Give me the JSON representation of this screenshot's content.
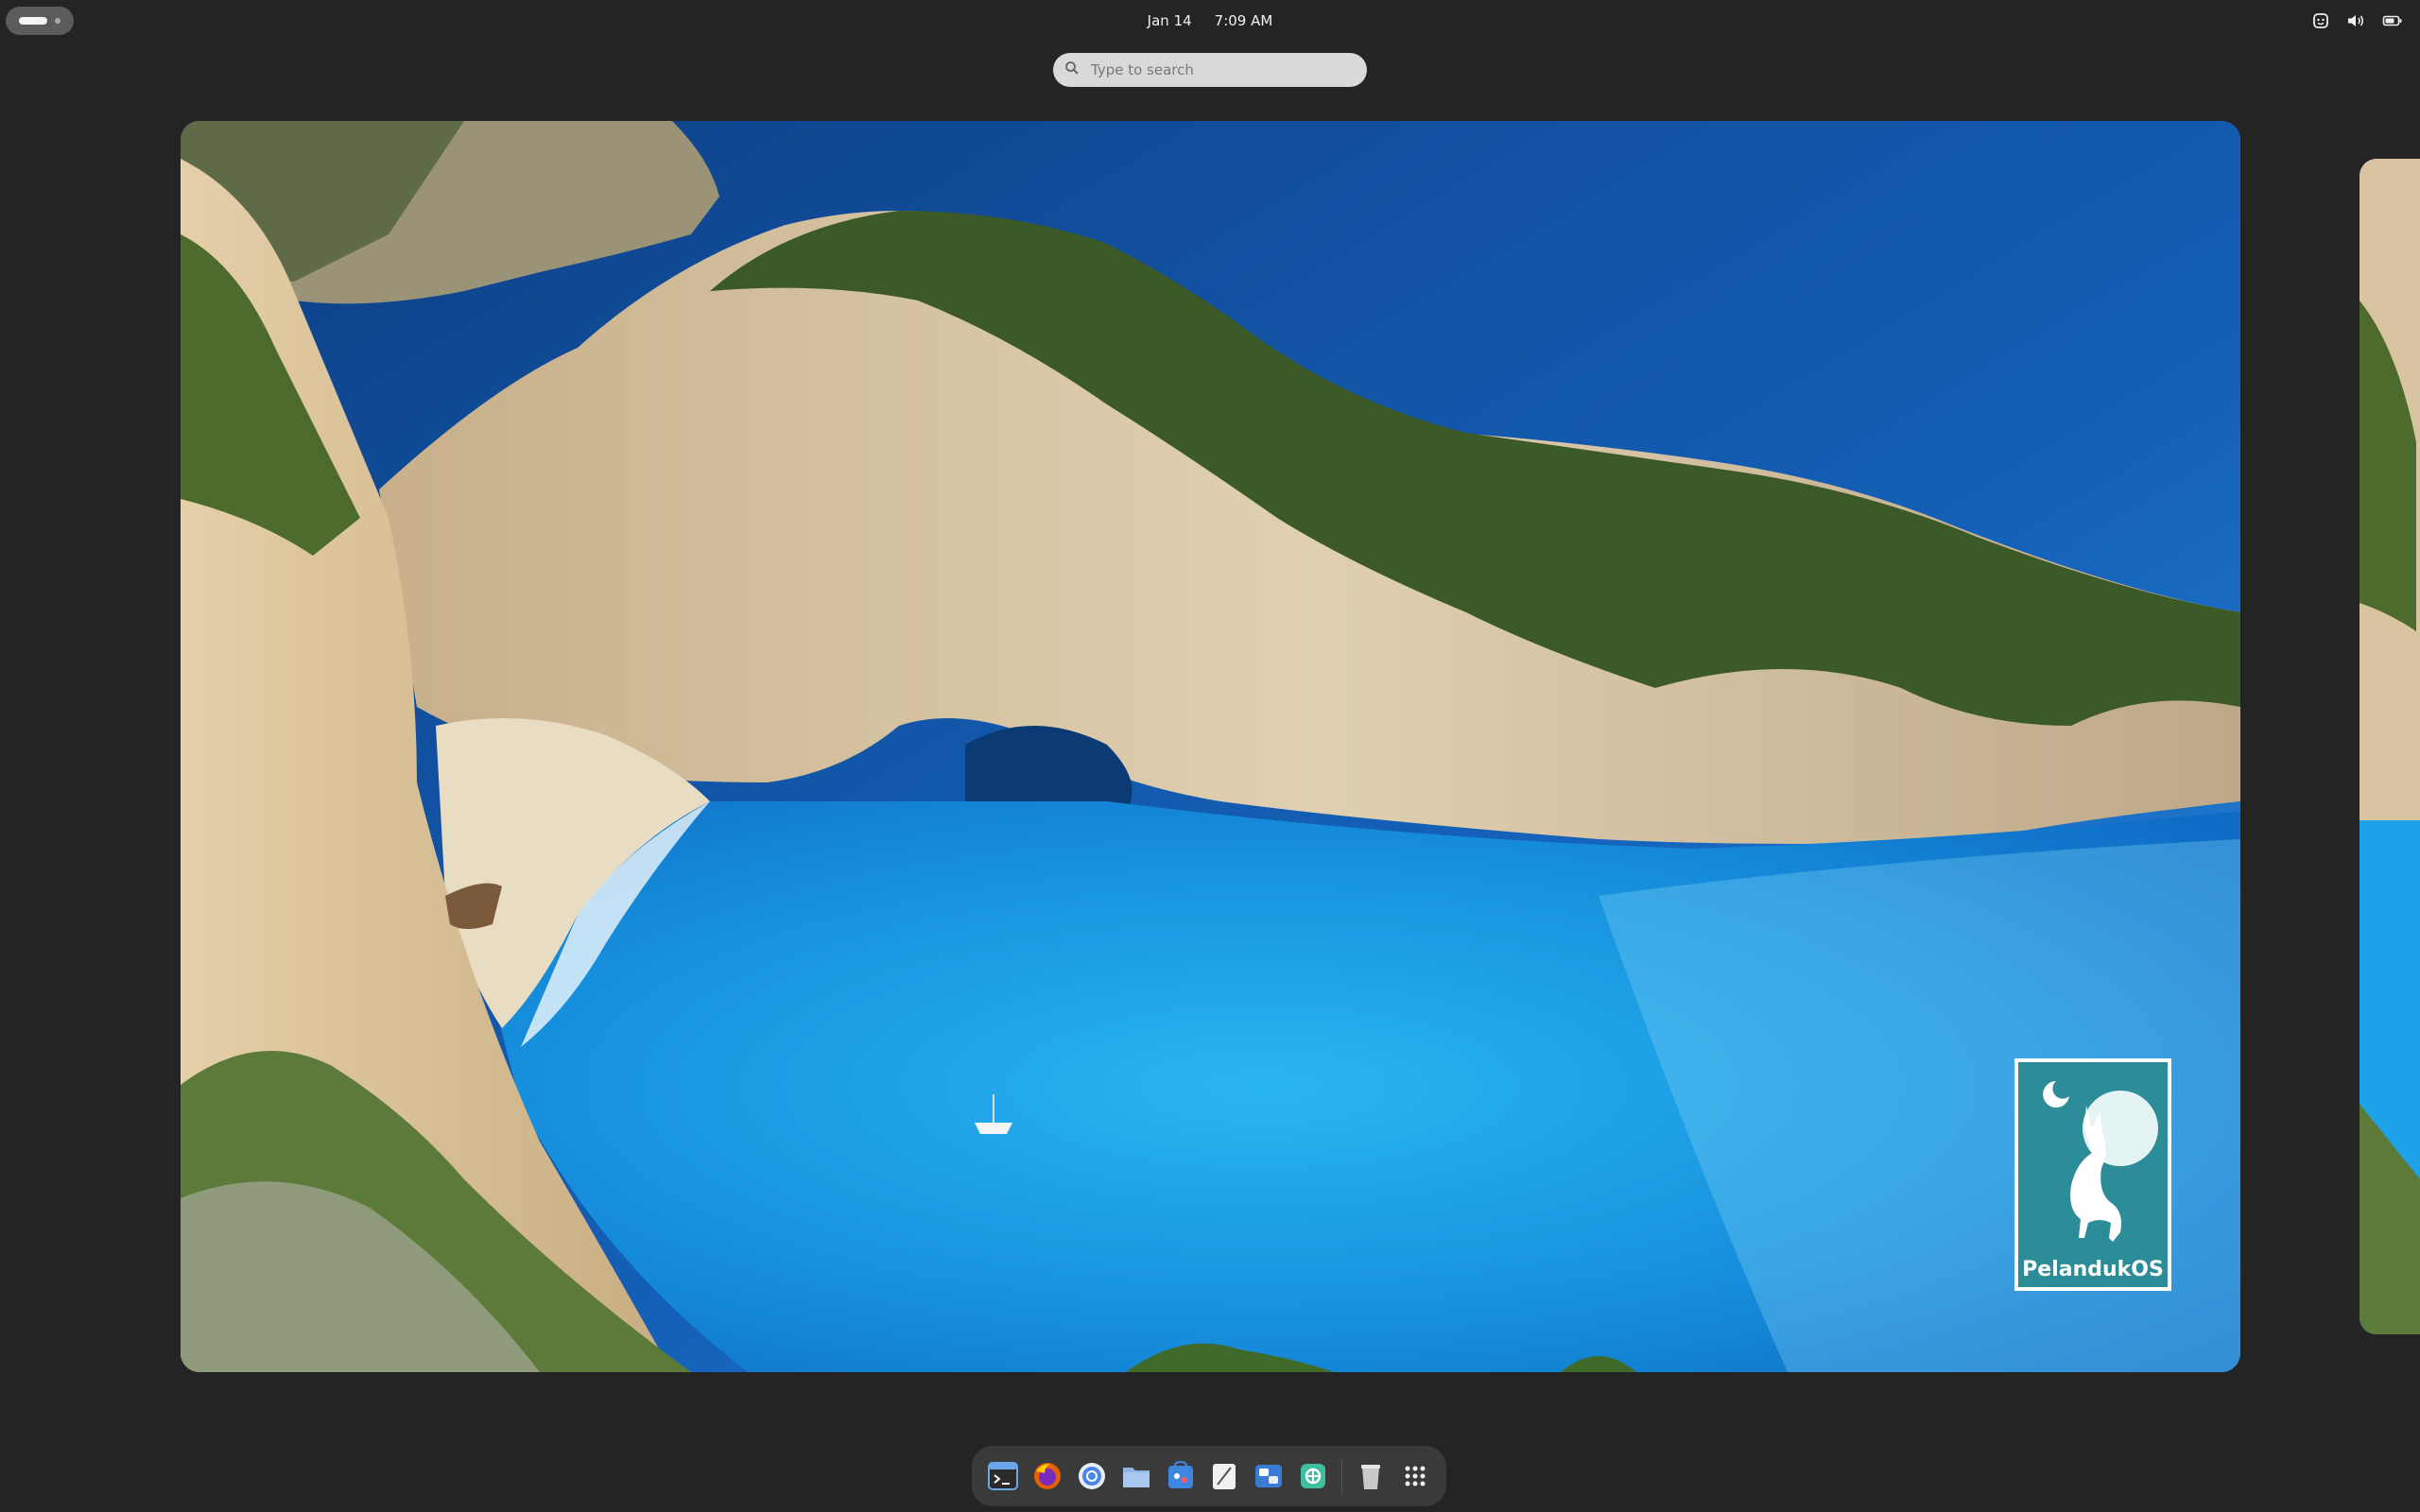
{
  "topbar": {
    "activities_label": "Activities",
    "date": "Jan 14",
    "time": "7:09 AM",
    "status_icons": [
      "accessibility-icon",
      "volume-icon",
      "battery-icon"
    ]
  },
  "search": {
    "placeholder": "Type to search"
  },
  "workspace": {
    "wallpaper_watermark": "PelandukOS",
    "colors": {
      "sky_sea_deep": "#0f4d97",
      "sea_shallow": "#1aa3ea",
      "cliff": "#d9c6a3",
      "forest": "#3f5e2a",
      "logo_teal": "#2c8d99"
    }
  },
  "dash": {
    "apps": [
      {
        "name": "Terminal",
        "icon": "terminal-icon"
      },
      {
        "name": "Firefox",
        "icon": "firefox-icon"
      },
      {
        "name": "Chromium",
        "icon": "chromium-icon"
      },
      {
        "name": "Files",
        "icon": "files-icon"
      },
      {
        "name": "Software",
        "icon": "software-icon"
      },
      {
        "name": "Text Editor",
        "icon": "text-editor-icon"
      },
      {
        "name": "Settings",
        "icon": "settings-icon"
      },
      {
        "name": "Extension Manager",
        "icon": "extension-icon"
      },
      {
        "name": "Trash",
        "icon": "trash-icon"
      },
      {
        "name": "Show Applications",
        "icon": "app-grid-icon"
      }
    ]
  }
}
